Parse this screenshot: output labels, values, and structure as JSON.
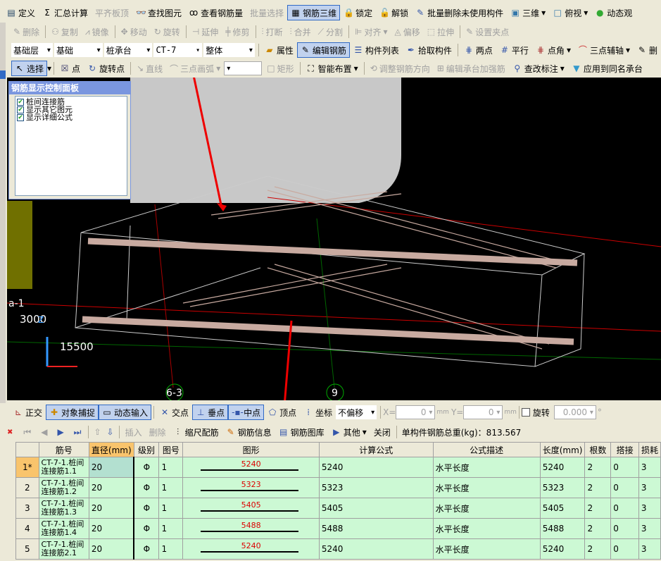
{
  "toolbar1": [
    "定义",
    "汇总计算",
    "平齐板顶",
    "查找图元",
    "查看钢筋量",
    "批量选择",
    "钢筋三维",
    "锁定",
    "解锁",
    "批量删除未使用构件",
    "三维",
    "俯视",
    "动态观"
  ],
  "toolbar2": [
    "删除",
    "复制",
    "镜像",
    "移动",
    "旋转",
    "延伸",
    "修剪",
    "打断",
    "合并",
    "分割",
    "对齐",
    "偏移",
    "拉伸",
    "设置夹点"
  ],
  "toolbar3": {
    "floor": "基础层",
    "category": "基础",
    "type": "桩承台",
    "component": "CT-7",
    "scope": "整体",
    "buttons": [
      "属性",
      "编辑钢筋",
      "构件列表",
      "拾取构件",
      "两点",
      "平行",
      "点角",
      "三点辅轴",
      "删"
    ]
  },
  "toolbar4": {
    "buttons": [
      "选择",
      "点",
      "旋转点",
      "直线",
      "三点画弧",
      "矩形",
      "智能布置",
      "调整钢筋方向",
      "编辑承台加强筋",
      "查改标注",
      "应用到同名承台"
    ]
  },
  "panel": {
    "title": "钢筋显示控制面板",
    "items": [
      "桩间连接筋",
      "显示其它图元",
      "显示详细公式"
    ]
  },
  "viewport": {
    "axis_labels": [
      "a-1",
      "6-3",
      "9"
    ],
    "dims": [
      "3000",
      "15500"
    ]
  },
  "snap": {
    "buttons": [
      "正交",
      "对象捕捉",
      "动态输入",
      "交点",
      "垂点",
      "中点",
      "顶点",
      "坐标"
    ],
    "offset": "不偏移",
    "x_label": "X=",
    "x": "0",
    "y_label": "Y=",
    "y": "0",
    "unit": "mm",
    "rotate": "旋转",
    "angle": "0.000",
    "deg": "°"
  },
  "rebar_toolbar": {
    "buttons": [
      "插入",
      "删除",
      "缩尺配筋",
      "钢筋信息",
      "钢筋图库",
      "其他",
      "关闭"
    ],
    "total": "单构件钢筋总重(kg)：813.567"
  },
  "table": {
    "headers": [
      "",
      "筋号",
      "直径(mm)",
      "级别",
      "图号",
      "图形",
      "计算公式",
      "公式描述",
      "长度(mm)",
      "根数",
      "搭接",
      "损耗"
    ],
    "rows": [
      [
        "1*",
        "CT-7-1.桩间连接筋1.1",
        "20",
        "Φ",
        "1",
        "5240",
        "5240",
        "水平长度",
        "5240",
        "2",
        "0",
        "3"
      ],
      [
        "2",
        "CT-7-1.桩间连接筋1.2",
        "20",
        "Φ",
        "1",
        "5323",
        "5323",
        "水平长度",
        "5323",
        "2",
        "0",
        "3"
      ],
      [
        "3",
        "CT-7-1.桩间连接筋1.3",
        "20",
        "Φ",
        "1",
        "5405",
        "5405",
        "水平长度",
        "5405",
        "2",
        "0",
        "3"
      ],
      [
        "4",
        "CT-7-1.桩间连接筋1.4",
        "20",
        "Φ",
        "1",
        "5488",
        "5488",
        "水平长度",
        "5488",
        "2",
        "0",
        "3"
      ],
      [
        "5",
        "CT-7-1.桩间连接筋2.1",
        "20",
        "Φ",
        "1",
        "5240",
        "5240",
        "水平长度",
        "5240",
        "2",
        "0",
        "3"
      ]
    ]
  }
}
